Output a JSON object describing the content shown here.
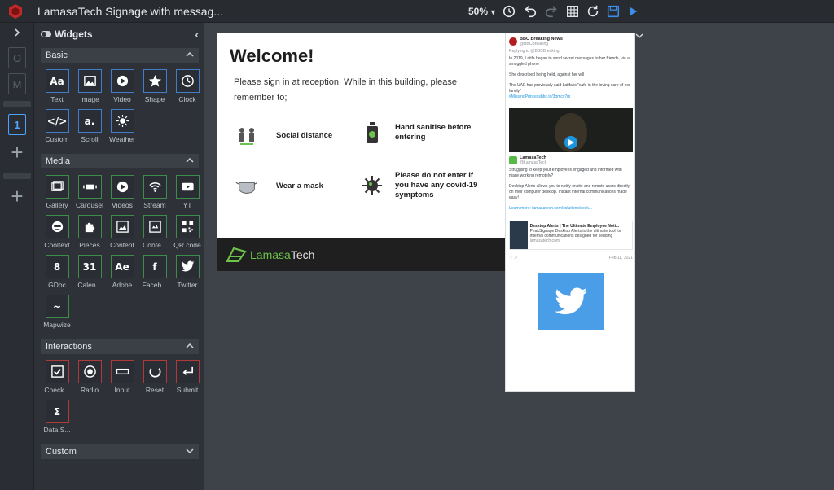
{
  "app": {
    "title": "LamasaTech Signage with messag...",
    "zoom": "50%"
  },
  "rail": {
    "pages": [
      "1"
    ]
  },
  "panel": {
    "title": "Widgets",
    "sections": {
      "basic": "Basic",
      "media": "Media",
      "interactions": "Interactions",
      "custom": "Custom"
    },
    "basic_widgets": [
      "Text",
      "Image",
      "Video",
      "Shape",
      "Clock",
      "Custom",
      "Scroll",
      "Weather"
    ],
    "basic_widget_glyphs": [
      "Aa",
      "",
      "",
      "",
      "",
      "</>",
      "a.",
      ""
    ],
    "media_widgets": [
      "Gallery",
      "Carousel",
      "Videos",
      "Stream",
      "YT",
      "Cooltext",
      "Pieces",
      "Content",
      "Conte...",
      "QR code",
      "GDoc",
      "Calen...",
      "Adobe",
      "Faceb...",
      "Twitter",
      "Mapwize"
    ],
    "media_widget_glyphs": [
      "",
      "",
      "",
      "",
      "",
      "",
      "",
      "",
      "",
      "",
      "8",
      "31",
      "Ae",
      "f",
      "",
      "~"
    ],
    "interaction_widgets": [
      "Check...",
      "Radio",
      "Input",
      "Reset",
      "Submit",
      "Data S..."
    ],
    "interaction_widget_glyphs": [
      "",
      "",
      "",
      "",
      "",
      "Σ"
    ]
  },
  "slide": {
    "title": "Welcome!",
    "intro": "Please sign in at reception. While in this building, please remember to;",
    "items": [
      "Social distance",
      "Hand sanitise before entering",
      "Wear a mask",
      "Please do not enter if you have any covid-19 symptoms"
    ],
    "brand_a": "Lamasa",
    "brand_b": "Tech"
  },
  "feed": {
    "tweet1": {
      "name": "BBC Breaking News",
      "handle": "@BBCBreaking",
      "reply": "Replying to @BBCBreaking",
      "p1": "In 2019, Latifa began to send secret messages to her friends, via a smuggled phone",
      "p2": "She described being held, against her will",
      "p3": "The UAE has previously said Latifa is \"safe in the loving care of her family\"",
      "tag": "#MissingPrincessbbc.in/3qmcv7m"
    },
    "tweet2": {
      "name": "LamasaTech",
      "handle": "@LamasaTech",
      "p1": "Struggling to keep your employees engaged and informed with many working remotely?",
      "p2": "Desktop Alerts allows you to notify onsite and remote users directly on their computer desktop. Instant internal communications made easy!",
      "p3": "Learn more: lamasatech.com/solutions/desk...",
      "card_title": "Desktop Alerts | The Ultimate Employee Noti...",
      "card_body": "PeakSignage Desktop Alerts is the ultimate tool for internal communications designed for sending",
      "card_domain": "lamasatech.com",
      "date": "Feb 11, 2021"
    }
  },
  "colors": {
    "accent_blue": "#4da3ff",
    "brand_green": "#6cc24a",
    "twitter_blue": "#4a9ee8"
  }
}
